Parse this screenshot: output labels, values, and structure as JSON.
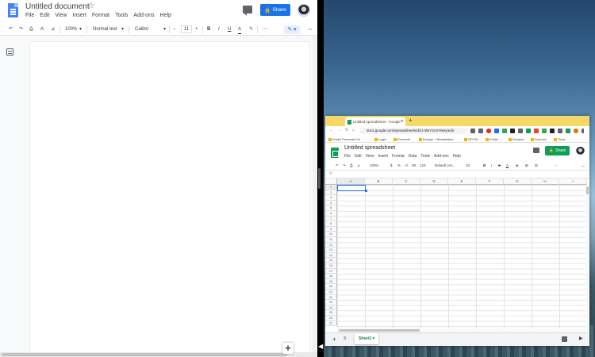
{
  "docs": {
    "title": "Untitled document",
    "star": "☆",
    "menus": [
      "File",
      "Edit",
      "View",
      "Insert",
      "Format",
      "Tools",
      "Add-ons",
      "Help"
    ],
    "share_label": "Share",
    "toolbar": {
      "undo": "↶",
      "redo": "↷",
      "print": "⎙",
      "spellcheck": "A",
      "paint": "⊿",
      "zoom": "100%",
      "style": "Normal text",
      "font": "Calibri",
      "minus": "−",
      "font_size": "11",
      "plus": "+",
      "bold": "B",
      "italic": "I",
      "underline": "U",
      "text_color": "A",
      "highlight": "✎",
      "more": "⋯",
      "edit_mode": "✎ ▾",
      "collapse": "︿"
    },
    "explore_icon": "✚"
  },
  "divider": {
    "arrow": "◀"
  },
  "chrome": {
    "tab_title": "Untitled spreadsheet - Google",
    "tab_close": "✕",
    "new_tab": "+",
    "nav": {
      "back": "←",
      "forward": "→",
      "reload": "↻",
      "home": "⌂"
    },
    "url": "docs.google.com/spreadsheets/d/1I-3NiY3A2Ytkey/edit",
    "bookmarks": [
      "Kristin Personal Col",
      "Login",
      "Evernote",
      "Essays + Newsletters",
      "OR RU",
      "Kristin",
      "Recipes",
      "Sources",
      "Tools"
    ]
  },
  "sheets": {
    "title": "Untitled spreadsheet",
    "menus": [
      "File",
      "Edit",
      "View",
      "Insert",
      "Format",
      "Data",
      "Tools",
      "Add-ons",
      "Help"
    ],
    "share_label": "Share",
    "toolbar": {
      "undo": "↶",
      "redo": "↷",
      "print": "⎙",
      "paint": "⊿",
      "zoom": "100%",
      "currency": "$",
      "percent": "%",
      "dec_less": ".0",
      "dec_more": ".00",
      "format": "123",
      "font": "Default (Ari...",
      "font_size": "10",
      "bold": "B",
      "italic": "I",
      "strike": "S",
      "text_color": "A",
      "fill": "◈",
      "borders": "⊞",
      "merge": "⊟",
      "more": "⋯",
      "collapse": "︿"
    },
    "fx": "fx",
    "columns": [
      "A",
      "B",
      "C",
      "D",
      "E",
      "F",
      "G",
      "H",
      "I"
    ],
    "rows": [
      "1",
      "2",
      "3",
      "4",
      "5",
      "6",
      "7",
      "8",
      "9",
      "10",
      "11",
      "12",
      "13",
      "14",
      "15",
      "16",
      "17",
      "18",
      "19",
      "20",
      "21",
      "22",
      "23",
      "24",
      "25",
      "26",
      "27"
    ],
    "sheet_tab": "Sheet1 ▾",
    "add_sheet": "+",
    "sheet_menu": "≡",
    "collapse_icon": "▶"
  }
}
